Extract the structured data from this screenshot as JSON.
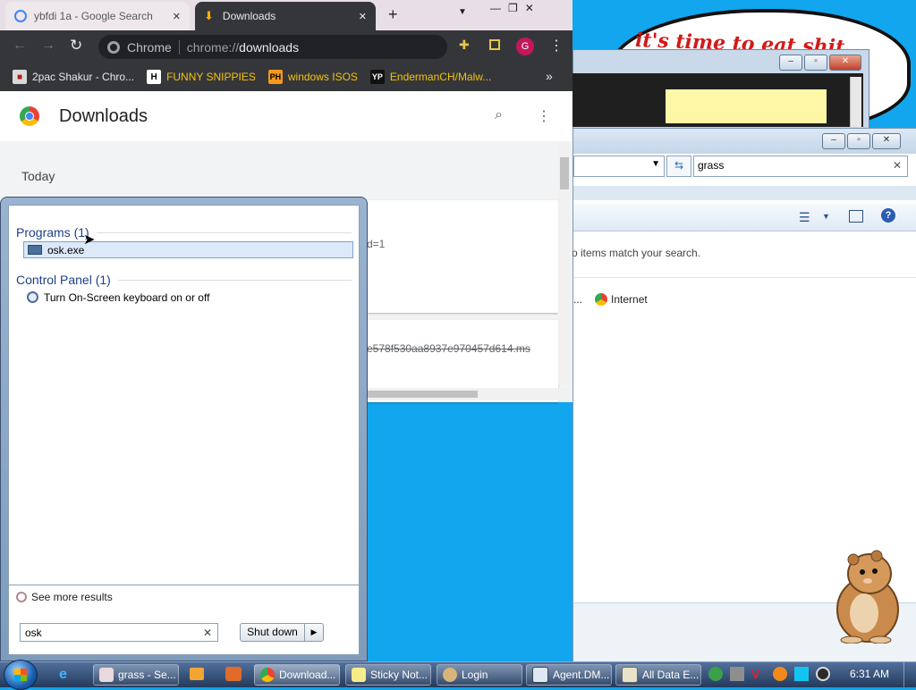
{
  "desktop": {
    "cloud_text": "it's time to eat shit"
  },
  "chrome": {
    "tabs": [
      {
        "label": "ybfdi 1a - Google Search",
        "close": "✕"
      },
      {
        "label": "Downloads",
        "close": "✕"
      }
    ],
    "new_tab": "+",
    "omnibox": {
      "site_label": "Chrome",
      "url_scheme": "chrome://",
      "url_path": "downloads"
    },
    "profile_initial": "G",
    "bookmarks": [
      {
        "label": "2pac Shakur - Chro...",
        "icon": "bookmark-icon"
      },
      {
        "label": "FUNNY SNIPPIES",
        "icon": "H"
      },
      {
        "label": "windows ISOS",
        "icon": "PH"
      },
      {
        "label": "EndermanCH/Malw...",
        "icon": "YP"
      }
    ],
    "bookmarks_overflow": "»",
    "downloads": {
      "title": "Downloads",
      "section": "Today",
      "item1_partial": "d=1",
      "item2_partial": "e578f530aa8937e970457d614.ms"
    }
  },
  "explorer": {
    "search_value": "grass",
    "no_items_text": "o items match your search.",
    "search_again_labels": [
      "...",
      "Internet"
    ]
  },
  "startmenu": {
    "groups": [
      {
        "header": "Programs (1)",
        "items": [
          {
            "label": "osk.exe",
            "selected": true
          }
        ]
      },
      {
        "header": "Control Panel (1)",
        "items": [
          {
            "label": "Turn On-Screen keyboard on or off",
            "selected": false
          }
        ]
      }
    ],
    "see_more": "See more results",
    "search_value": "osk",
    "shutdown_label": "Shut down"
  },
  "taskbar": {
    "buttons": [
      {
        "label": "grass - Se...",
        "icon": "search-icon"
      },
      {
        "label": "Download...",
        "icon": "chrome-icon"
      },
      {
        "label": "Sticky Not...",
        "icon": "sticky-notes-icon"
      },
      {
        "label": "Login",
        "icon": "user-icon"
      },
      {
        "label": "Agent.DM...",
        "icon": "window-icon"
      },
      {
        "label": "All Data E...",
        "icon": "folder-icon"
      }
    ],
    "clock": "6:31 AM"
  },
  "colors": {
    "desktop_blue": "#12a6ee",
    "chrome_dark": "#35363a",
    "startmenu_header": "#1e3f84",
    "selection": "#dde9f8"
  }
}
